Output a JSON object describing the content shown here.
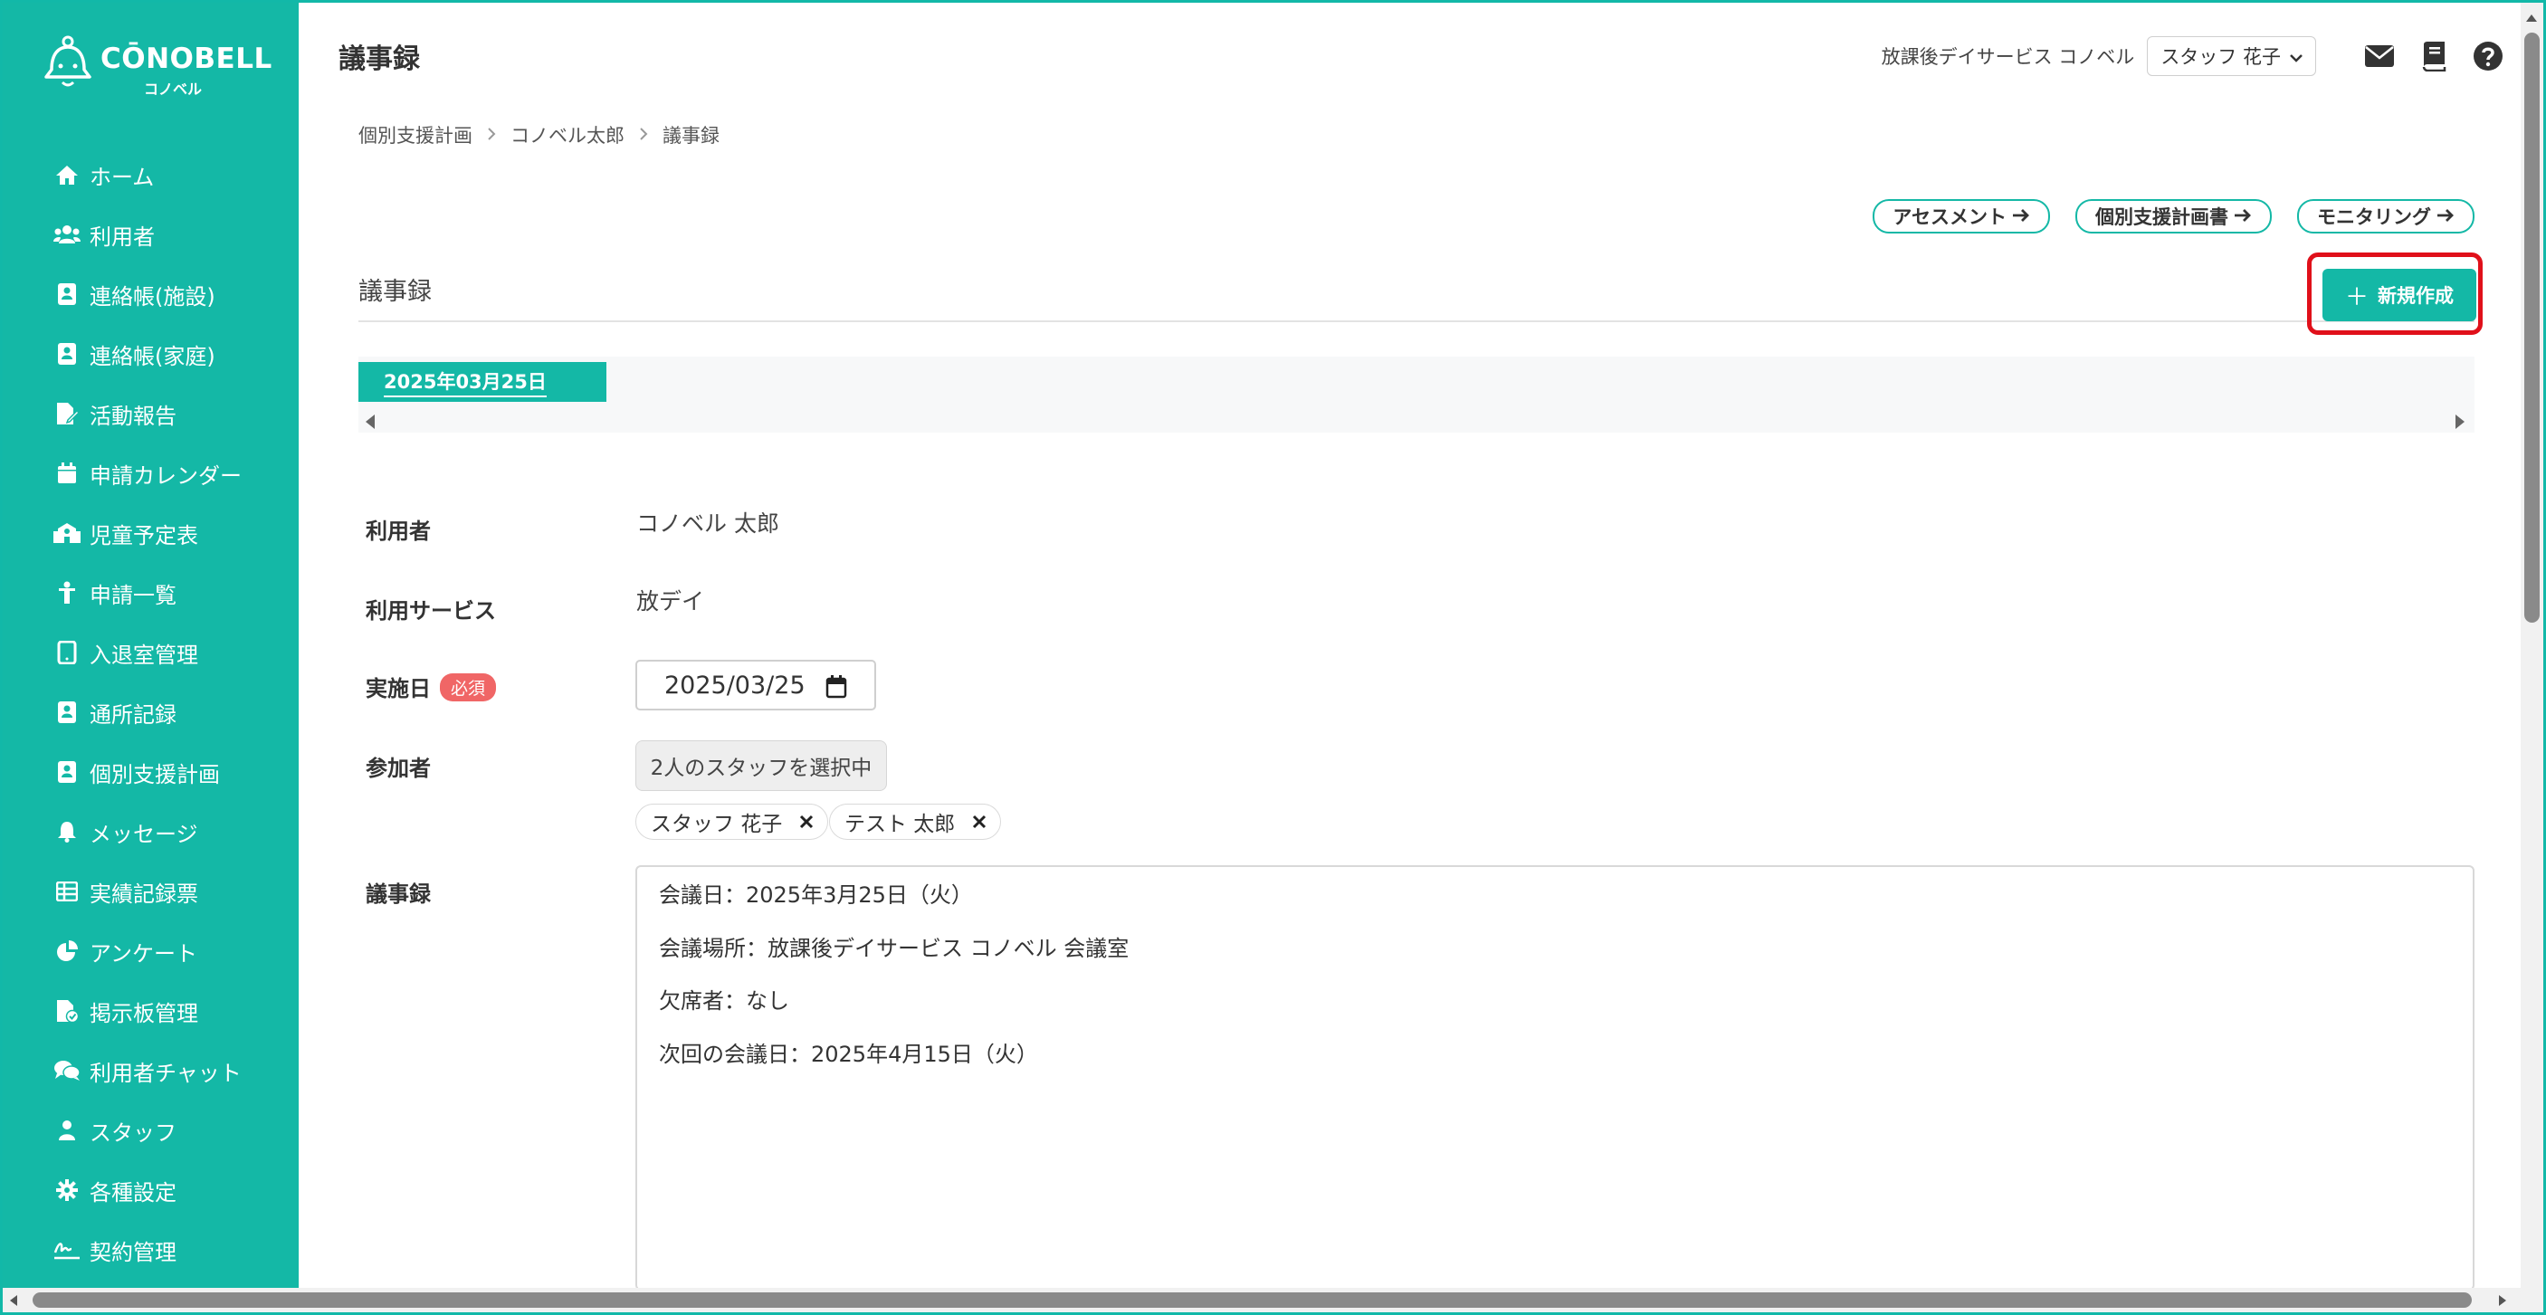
{
  "brand": {
    "name": "CŌNOBELL",
    "sub": "コノベル"
  },
  "colors": {
    "primary": "#14b8a6",
    "highlight_outline": "#e0101a",
    "required": "#f06666"
  },
  "sidebar": {
    "items": [
      {
        "label": "ホーム",
        "icon": "home-icon"
      },
      {
        "label": "利用者",
        "icon": "users-icon"
      },
      {
        "label": "連絡帳(施設)",
        "icon": "contact-book-icon"
      },
      {
        "label": "連絡帳(家庭)",
        "icon": "contact-book-icon"
      },
      {
        "label": "活動報告",
        "icon": "file-edit-icon"
      },
      {
        "label": "申請カレンダー",
        "icon": "calendar-icon"
      },
      {
        "label": "児童予定表",
        "icon": "school-icon"
      },
      {
        "label": "申請一覧",
        "icon": "child-icon"
      },
      {
        "label": "入退室管理",
        "icon": "tablet-icon"
      },
      {
        "label": "通所記録",
        "icon": "contact-book-icon"
      },
      {
        "label": "個別支援計画",
        "icon": "contact-book-icon"
      },
      {
        "label": "メッセージ",
        "icon": "bell-icon"
      },
      {
        "label": "実績記録票",
        "icon": "table-icon"
      },
      {
        "label": "アンケート",
        "icon": "pie-chart-icon"
      },
      {
        "label": "掲示板管理",
        "icon": "file-check-icon"
      },
      {
        "label": "利用者チャット",
        "icon": "chat-icon"
      },
      {
        "label": "スタッフ",
        "icon": "user-icon"
      },
      {
        "label": "各種設定",
        "icon": "gear-icon"
      },
      {
        "label": "契約管理",
        "icon": "signature-icon"
      }
    ]
  },
  "header": {
    "title": "議事録",
    "facility": "放課後デイサービス コノベル",
    "staff_selected": "スタッフ 花子",
    "icons": [
      "mail-icon",
      "book-icon",
      "help-icon"
    ]
  },
  "breadcrumb": [
    "個別支援計画",
    "コノベル太郎",
    "議事録"
  ],
  "top_links": [
    "アセスメント",
    "個別支援計画書",
    "モニタリング"
  ],
  "section": {
    "title": "議事録",
    "new_button": "新規作成"
  },
  "date_tabs": [
    "2025年03月25日"
  ],
  "form": {
    "user_label": "利用者",
    "user_value": "コノベル 太郎",
    "service_label": "利用サービス",
    "service_value": "放デイ",
    "date_label": "実施日",
    "required_badge": "必須",
    "date_value": "2025/03/25",
    "participants_label": "参加者",
    "participants_button": "2人のスタッフを選択中",
    "participants": [
      "スタッフ 花子",
      "テスト 太郎"
    ],
    "minutes_label": "議事録",
    "minutes_lines": [
      "会議日：2025年3月25日（火）",
      "会議場所：放課後デイサービス コノベル 会議室",
      "欠席者：なし",
      "次回の会議日：2025年4月15日（火）"
    ]
  }
}
